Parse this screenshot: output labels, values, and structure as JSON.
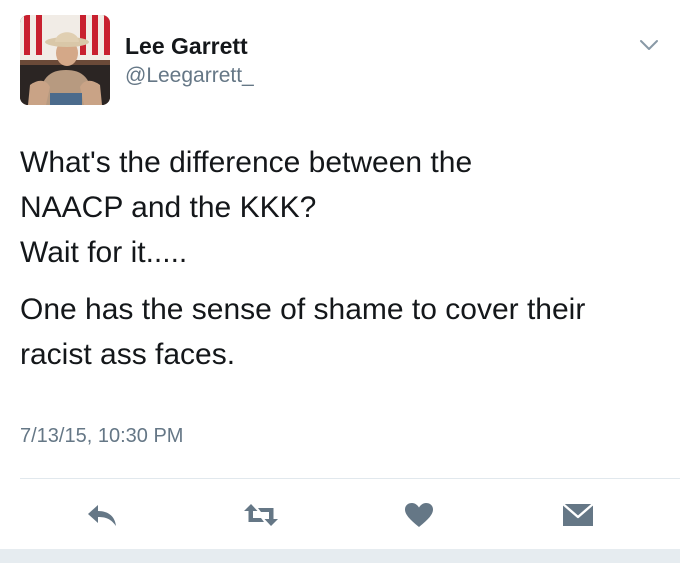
{
  "author": {
    "display_name": "Lee Garrett",
    "handle": "@Leegarrett_"
  },
  "tweet": {
    "lines_para1": [
      "What's the difference between the",
      "NAACP and the KKK?",
      "Wait for it....."
    ],
    "lines_para2": [
      "One has the sense of shame to cover their",
      "racist ass faces."
    ],
    "timestamp": "7/13/15, 10:30 PM"
  },
  "actions": [
    "reply",
    "retweet",
    "like",
    "direct-message"
  ],
  "icons": {
    "menu": "chevron-down-icon",
    "reply": "reply-icon",
    "retweet": "retweet-icon",
    "like": "heart-icon",
    "dm": "envelope-icon"
  },
  "colors": {
    "text": "#14171a",
    "secondary_text": "#657786",
    "icon": "#657786",
    "divider": "#e1e8ed",
    "footer_bar": "#e6ecf0"
  }
}
